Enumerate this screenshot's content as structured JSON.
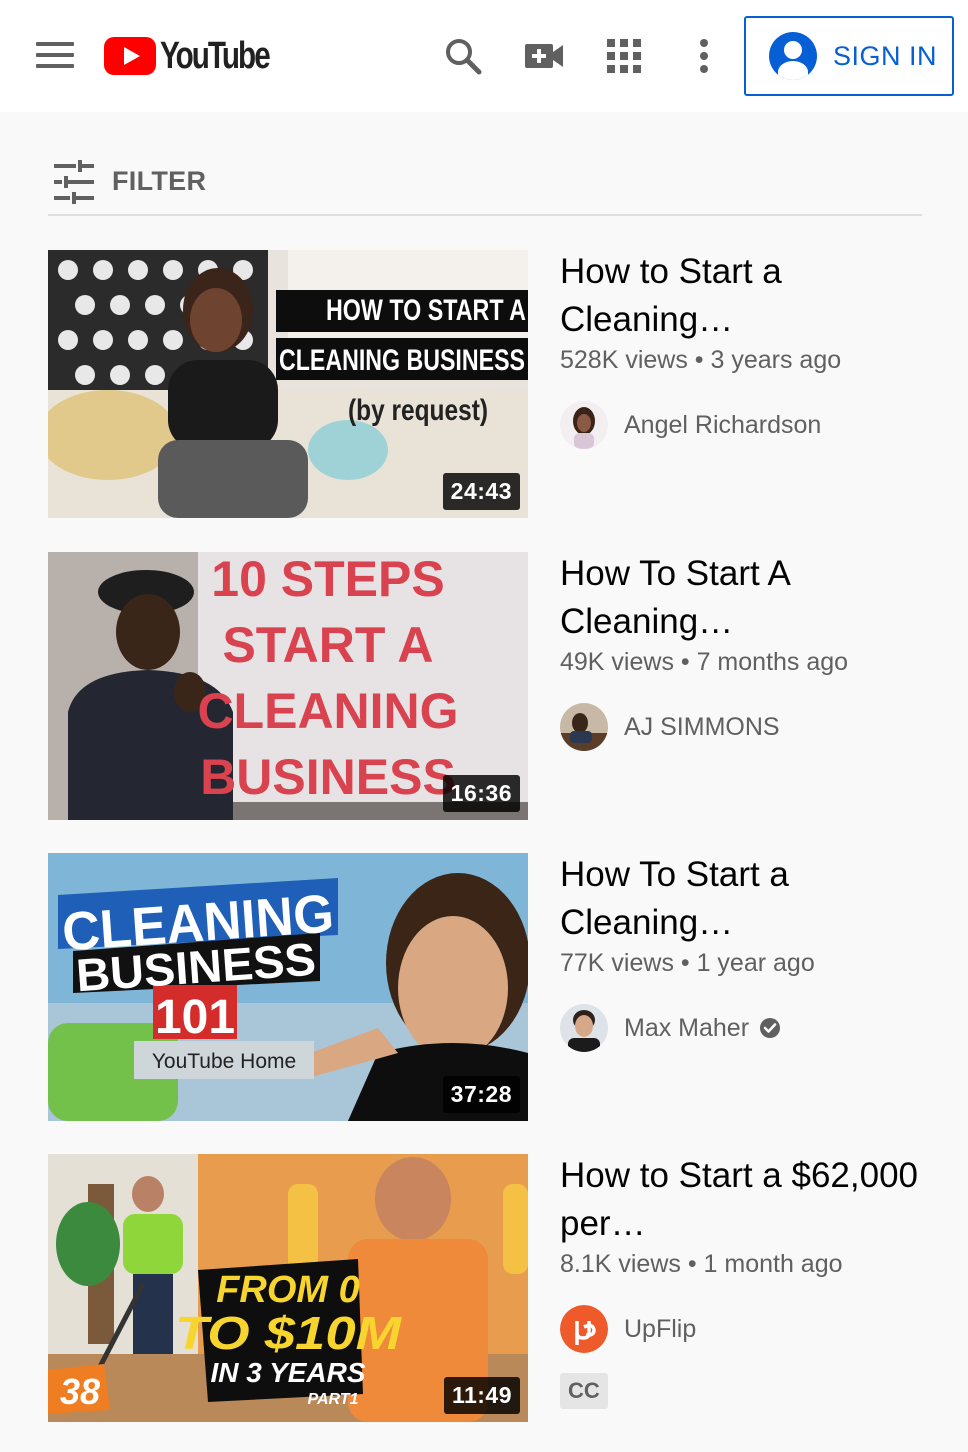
{
  "header": {
    "logo_text": "YouTube",
    "icons": [
      "menu-icon",
      "search-icon",
      "create-video-icon",
      "apps-icon",
      "more-vert-icon"
    ],
    "sign_in_label": "SIGN IN",
    "accent_color": "#065fd4",
    "brand_color": "#ff0000"
  },
  "filter": {
    "label": "FILTER",
    "icon": "filter-sliders-icon"
  },
  "videos": [
    {
      "title": "How to Start a Cleaning…",
      "stats": "528K views • 3 years ago",
      "channel": "Angel Richardson",
      "duration": "24:43",
      "thumb_text": [
        "HOW TO START A",
        "CLEANING BUSINESS",
        "(by request)"
      ]
    },
    {
      "title": "How To Start A Cleaning…",
      "stats": "49K views • 7 months ago",
      "channel": "AJ SIMMONS",
      "duration": "16:36",
      "thumb_text": [
        "10 STEPS",
        "START A",
        "CLEANING",
        "BUSINESS"
      ]
    },
    {
      "title": "How To Start a Cleaning…",
      "stats": "77K views • 1 year ago",
      "channel": "Max Maher",
      "verified": true,
      "duration": "37:28",
      "thumb_text": [
        "CLEANING",
        "BUSINESS",
        "101",
        "YouTube Home"
      ]
    },
    {
      "title": "How to Start a $62,000 per…",
      "stats": "8.1K views • 1 month ago",
      "channel": "UpFlip",
      "duration": "11:49",
      "badge": "CC",
      "thumb_text": [
        "FROM 0",
        "TO $10M",
        "IN 3 YEARS",
        "PART1",
        "38"
      ]
    }
  ]
}
